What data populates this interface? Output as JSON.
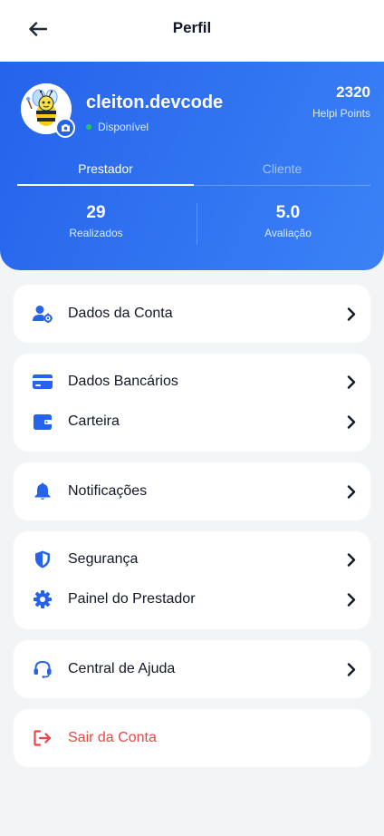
{
  "header": {
    "title": "Perfil"
  },
  "profile": {
    "username": "cleiton.devcode",
    "status": "Disponível",
    "points_value": "2320",
    "points_label": "Helpi Points"
  },
  "tabs": [
    {
      "label": "Prestador",
      "active": true
    },
    {
      "label": "Cliente",
      "active": false
    }
  ],
  "stats": [
    {
      "value": "29",
      "label": "Realizados"
    },
    {
      "value": "5.0",
      "label": "Avaliação"
    }
  ],
  "menu": {
    "account": {
      "label": "Dados da Conta",
      "icon": "user-gear-icon"
    },
    "bank": {
      "label": "Dados Bancários",
      "icon": "credit-card-icon"
    },
    "wallet": {
      "label": "Carteira",
      "icon": "wallet-icon"
    },
    "notifications": {
      "label": "Notificações",
      "icon": "bell-icon"
    },
    "security": {
      "label": "Segurança",
      "icon": "shield-icon"
    },
    "provider_panel": {
      "label": "Painel do Prestador",
      "icon": "gear-icon"
    },
    "help": {
      "label": "Central de Ajuda",
      "icon": "headset-icon"
    },
    "logout": {
      "label": "Sair da Conta",
      "icon": "logout-icon"
    }
  },
  "colors": {
    "accent": "#2563eb",
    "gradient_end": "#3b82f6",
    "danger": "#ef4444",
    "online": "#22c55e",
    "background": "#f3f4f6"
  }
}
